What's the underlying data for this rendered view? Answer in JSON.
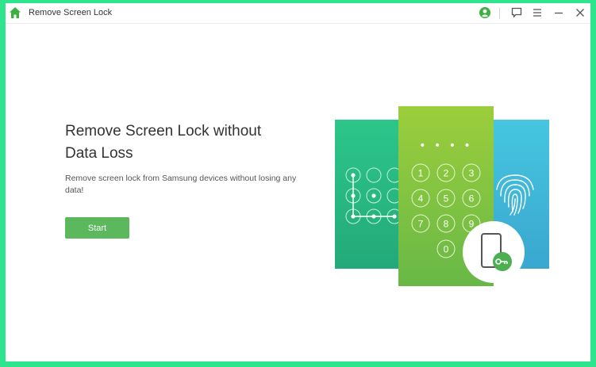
{
  "window": {
    "title": "Remove Screen Lock"
  },
  "titlebar": {
    "icons": [
      "home-icon",
      "account-icon",
      "feedback-icon",
      "menu-icon",
      "minimize-icon",
      "close-icon"
    ]
  },
  "main": {
    "headline_line1": "Remove Screen Lock without",
    "headline_line2": "Data Loss",
    "description_line1": "Remove screen lock from Samsung devices without losing any",
    "description_line2": "data!",
    "start_label": "Start"
  },
  "illustration": {
    "pin_dots": "• • • •",
    "keypad": [
      "1",
      "2",
      "3",
      "4",
      "5",
      "6",
      "7",
      "8",
      "9",
      "0"
    ]
  },
  "colors": {
    "border": "#2ee58e",
    "accent_green": "#5bb85c",
    "home_green": "#3cb043",
    "panel_teal": "#2bbf86",
    "panel_blue": "#3bb6d8",
    "panel_lime": "#8ec63f"
  }
}
